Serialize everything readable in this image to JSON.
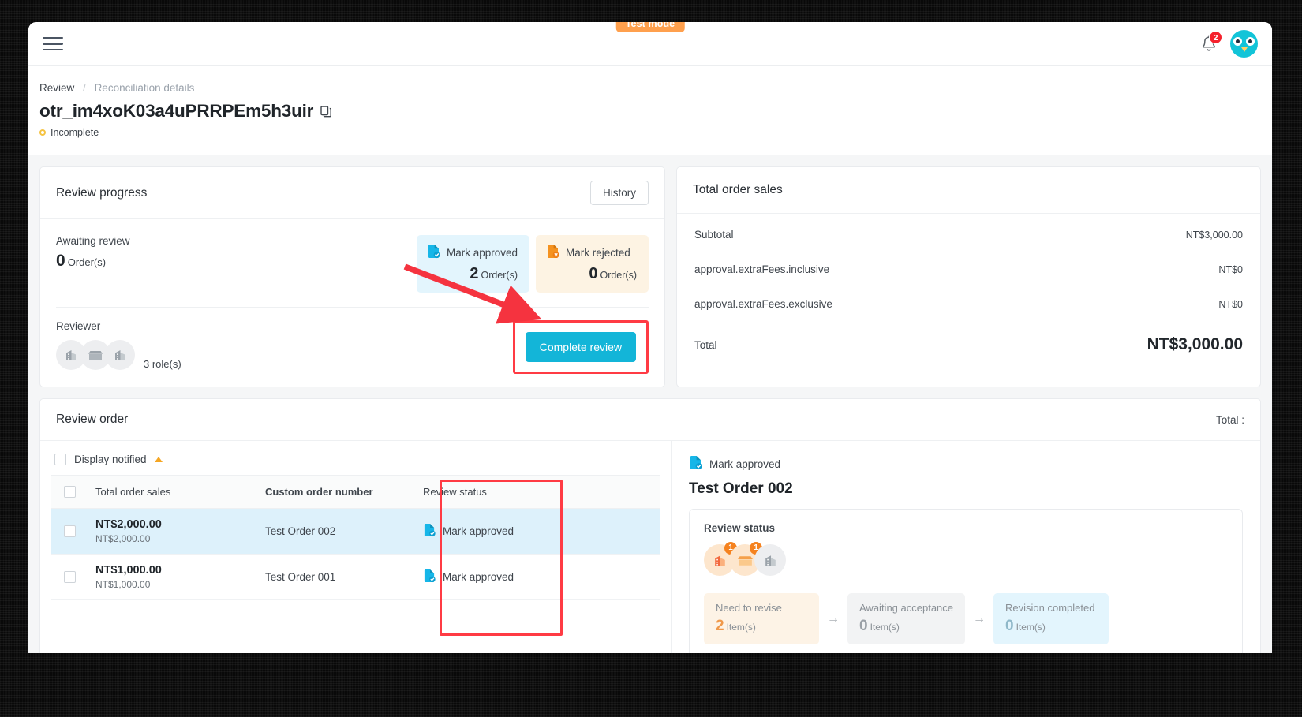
{
  "topbar": {
    "menu_icon": "hamburger-icon",
    "test_mode_label": "Test mode",
    "notification_count": "2",
    "bell_icon": "bell-icon",
    "avatar_icon": "user-avatar"
  },
  "breadcrumb": {
    "parent": "Review",
    "separator": "/",
    "current": "Reconciliation details"
  },
  "header": {
    "title": "otr_im4xoK03a4uPRRPEm5h3uir",
    "copy_icon": "copy-icon",
    "status": "Incomplete"
  },
  "review_progress": {
    "card_title": "Review progress",
    "history_button": "History",
    "awaiting_label": "Awaiting review",
    "awaiting_count": "0",
    "awaiting_unit": "Order(s)",
    "pills": [
      {
        "icon": "doc-check-icon",
        "label": "Mark approved",
        "count": "2",
        "unit": "Order(s)",
        "tone": "approved"
      },
      {
        "icon": "doc-x-icon",
        "label": "Mark rejected",
        "count": "0",
        "unit": "Order(s)",
        "tone": "rejected"
      }
    ],
    "reviewer_label": "Reviewer",
    "reviewer_roles": "3 role(s)",
    "complete_button": "Complete review"
  },
  "total_order_sales": {
    "card_title": "Total order sales",
    "rows": [
      {
        "label": "Subtotal",
        "value": "NT$3,000.00"
      },
      {
        "label": "approval.extraFees.inclusive",
        "value": "NT$0"
      },
      {
        "label": "approval.extraFees.exclusive",
        "value": "NT$0"
      }
    ],
    "total_label": "Total",
    "total_value": "NT$3,000.00"
  },
  "review_order": {
    "card_title": "Review order",
    "total_label": "Total :",
    "display_notified": "Display notified",
    "columns": [
      "",
      "Total order sales",
      "Custom order number",
      "Review status"
    ],
    "rows": [
      {
        "amount": "NT$2,000.00",
        "amount_sub": "NT$2,000.00",
        "order_number": "Test Order 002",
        "status": "Mark approved",
        "status_icon": "doc-check-icon",
        "selected": true
      },
      {
        "amount": "NT$1,000.00",
        "amount_sub": "NT$1,000.00",
        "order_number": "Test Order 001",
        "status": "Mark approved",
        "status_icon": "doc-check-icon",
        "selected": false
      }
    ]
  },
  "order_detail": {
    "mark_label": "Mark approved",
    "mark_icon": "doc-check-icon",
    "title": "Test Order 002",
    "status_box_title": "Review status",
    "avatars": [
      {
        "type": "building",
        "badge": "1",
        "tone": "orange"
      },
      {
        "type": "shop",
        "badge": "1",
        "tone": "orange"
      },
      {
        "type": "building",
        "badge": "",
        "tone": "grey"
      }
    ],
    "steps": [
      {
        "label": "Need to revise",
        "count": "2",
        "unit": "Item(s)",
        "tone": "orange"
      },
      {
        "label": "Awaiting acceptance",
        "count": "0",
        "unit": "Item(s)",
        "tone": "grey"
      },
      {
        "label": "Revision completed",
        "count": "0",
        "unit": "Item(s)",
        "tone": "blue"
      }
    ],
    "arrow": "→"
  },
  "colors": {
    "accent": "#13b5d8",
    "approved_bg": "#e3f5fd",
    "rejected_bg": "#fdf3e3",
    "annotation": "#ff3b44",
    "test_mode": "#ffa04d",
    "badge_red": "#f5222d"
  }
}
